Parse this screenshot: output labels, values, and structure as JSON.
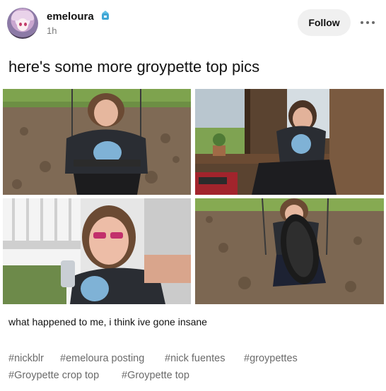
{
  "post": {
    "author": "emeloura",
    "timestamp": "1h",
    "follow_label": "Follow",
    "title": "here's some more groypette top pics",
    "caption": "what happened to me, i think ive gone insane",
    "tags": [
      "#nickblr",
      "#emeloura posting",
      "#nick fuentes",
      "#groypettes",
      "#Groypette crop top",
      "#Groypette top"
    ],
    "photo_count": 4
  },
  "colors": {
    "accent_badge": "#3fa7d6",
    "tag_text": "#6b6b6b",
    "follow_bg": "#f0f0f0"
  }
}
